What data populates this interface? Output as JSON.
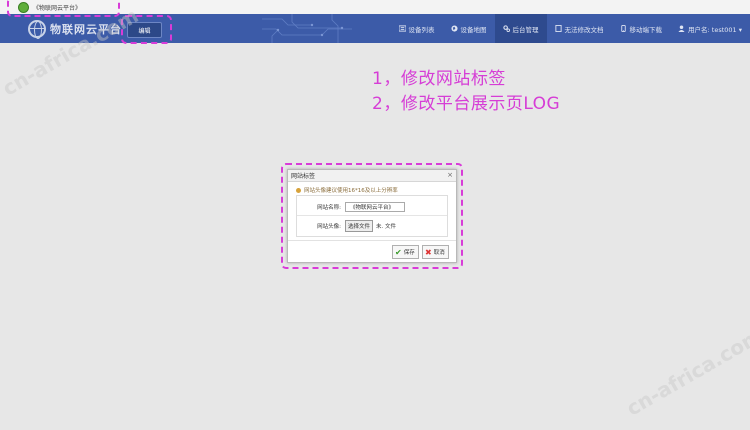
{
  "browser": {
    "tab_title": "《物联网云平台》"
  },
  "navbar": {
    "brand": "物联网云平台",
    "edit_label": "编辑",
    "items": [
      {
        "icon": "list-icon",
        "label": "设备列表"
      },
      {
        "icon": "globe-icon",
        "label": "设备地图"
      },
      {
        "icon": "cogs-icon",
        "label": "后台管理"
      },
      {
        "icon": "file-icon",
        "label": "无法修改文档"
      },
      {
        "icon": "mobile-icon",
        "label": "移动端下载"
      },
      {
        "icon": "user-icon",
        "label": "用户名: test001 ▾"
      }
    ]
  },
  "annotations": {
    "line1": "1，修改网站标签",
    "line2": "2，修改平台展示页LOG"
  },
  "dialog": {
    "title": "网站标签",
    "close_symbol": "×",
    "tip": "网站头像建议使用16*16及以上分辨率",
    "site_name_label": "网站名称:",
    "site_name_value": "《物联网云平台》",
    "site_avatar_label": "网站头像:",
    "choose_file_label": "选择文件",
    "file_status": "未. 文件",
    "save_label": "保存",
    "cancel_label": "取消"
  },
  "watermark": "cn-africa.com",
  "colors": {
    "navbar": "#3c5ba8",
    "annotation": "#d63dd6",
    "background": "#e7e7e7"
  }
}
